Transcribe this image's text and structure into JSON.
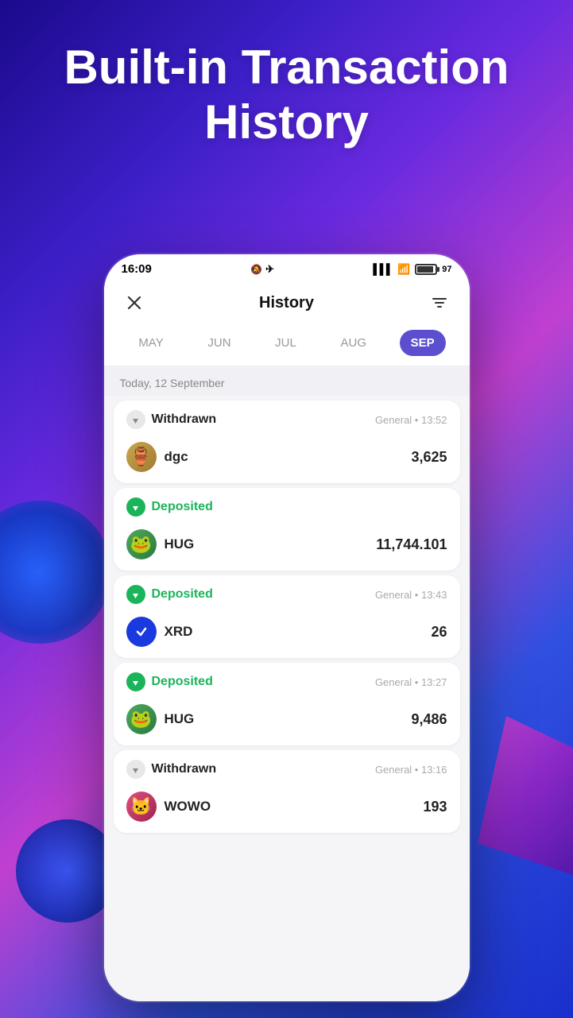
{
  "hero": {
    "title": "Built-in Transaction History"
  },
  "status_bar": {
    "time": "16:09",
    "battery_pct": "97"
  },
  "app": {
    "screen_title": "History",
    "close_label": "×",
    "filter_label": "⚙"
  },
  "months": [
    {
      "label": "MAY",
      "active": false
    },
    {
      "label": "JUN",
      "active": false
    },
    {
      "label": "JUL",
      "active": false
    },
    {
      "label": "AUG",
      "active": false
    },
    {
      "label": "SEP",
      "active": true
    }
  ],
  "date_header": "Today, 12 September",
  "transactions": [
    {
      "type": "Withdrawn",
      "type_style": "withdrawn",
      "meta": "General • 13:52",
      "coin_name": "dgc",
      "coin_emoji": "🏺",
      "coin_bg": "dgc",
      "amount": "3,625"
    },
    {
      "type": "Deposited",
      "type_style": "deposited",
      "meta": "",
      "coin_name": "HUG",
      "coin_emoji": "🐸",
      "coin_bg": "hug",
      "amount": "11,744.101"
    },
    {
      "type": "Deposited",
      "type_style": "deposited",
      "meta": "General • 13:43",
      "coin_name": "XRD",
      "coin_emoji": "✔",
      "coin_bg": "xrd",
      "amount": "26"
    },
    {
      "type": "Deposited",
      "type_style": "deposited",
      "meta": "General • 13:27",
      "coin_name": "HUG",
      "coin_emoji": "🐸",
      "coin_bg": "hug",
      "amount": "9,486"
    },
    {
      "type": "Withdrawn",
      "type_style": "withdrawn",
      "meta": "General • 13:16",
      "coin_name": "WOWO",
      "coin_emoji": "🐱",
      "coin_bg": "wowo",
      "amount": "193"
    }
  ]
}
